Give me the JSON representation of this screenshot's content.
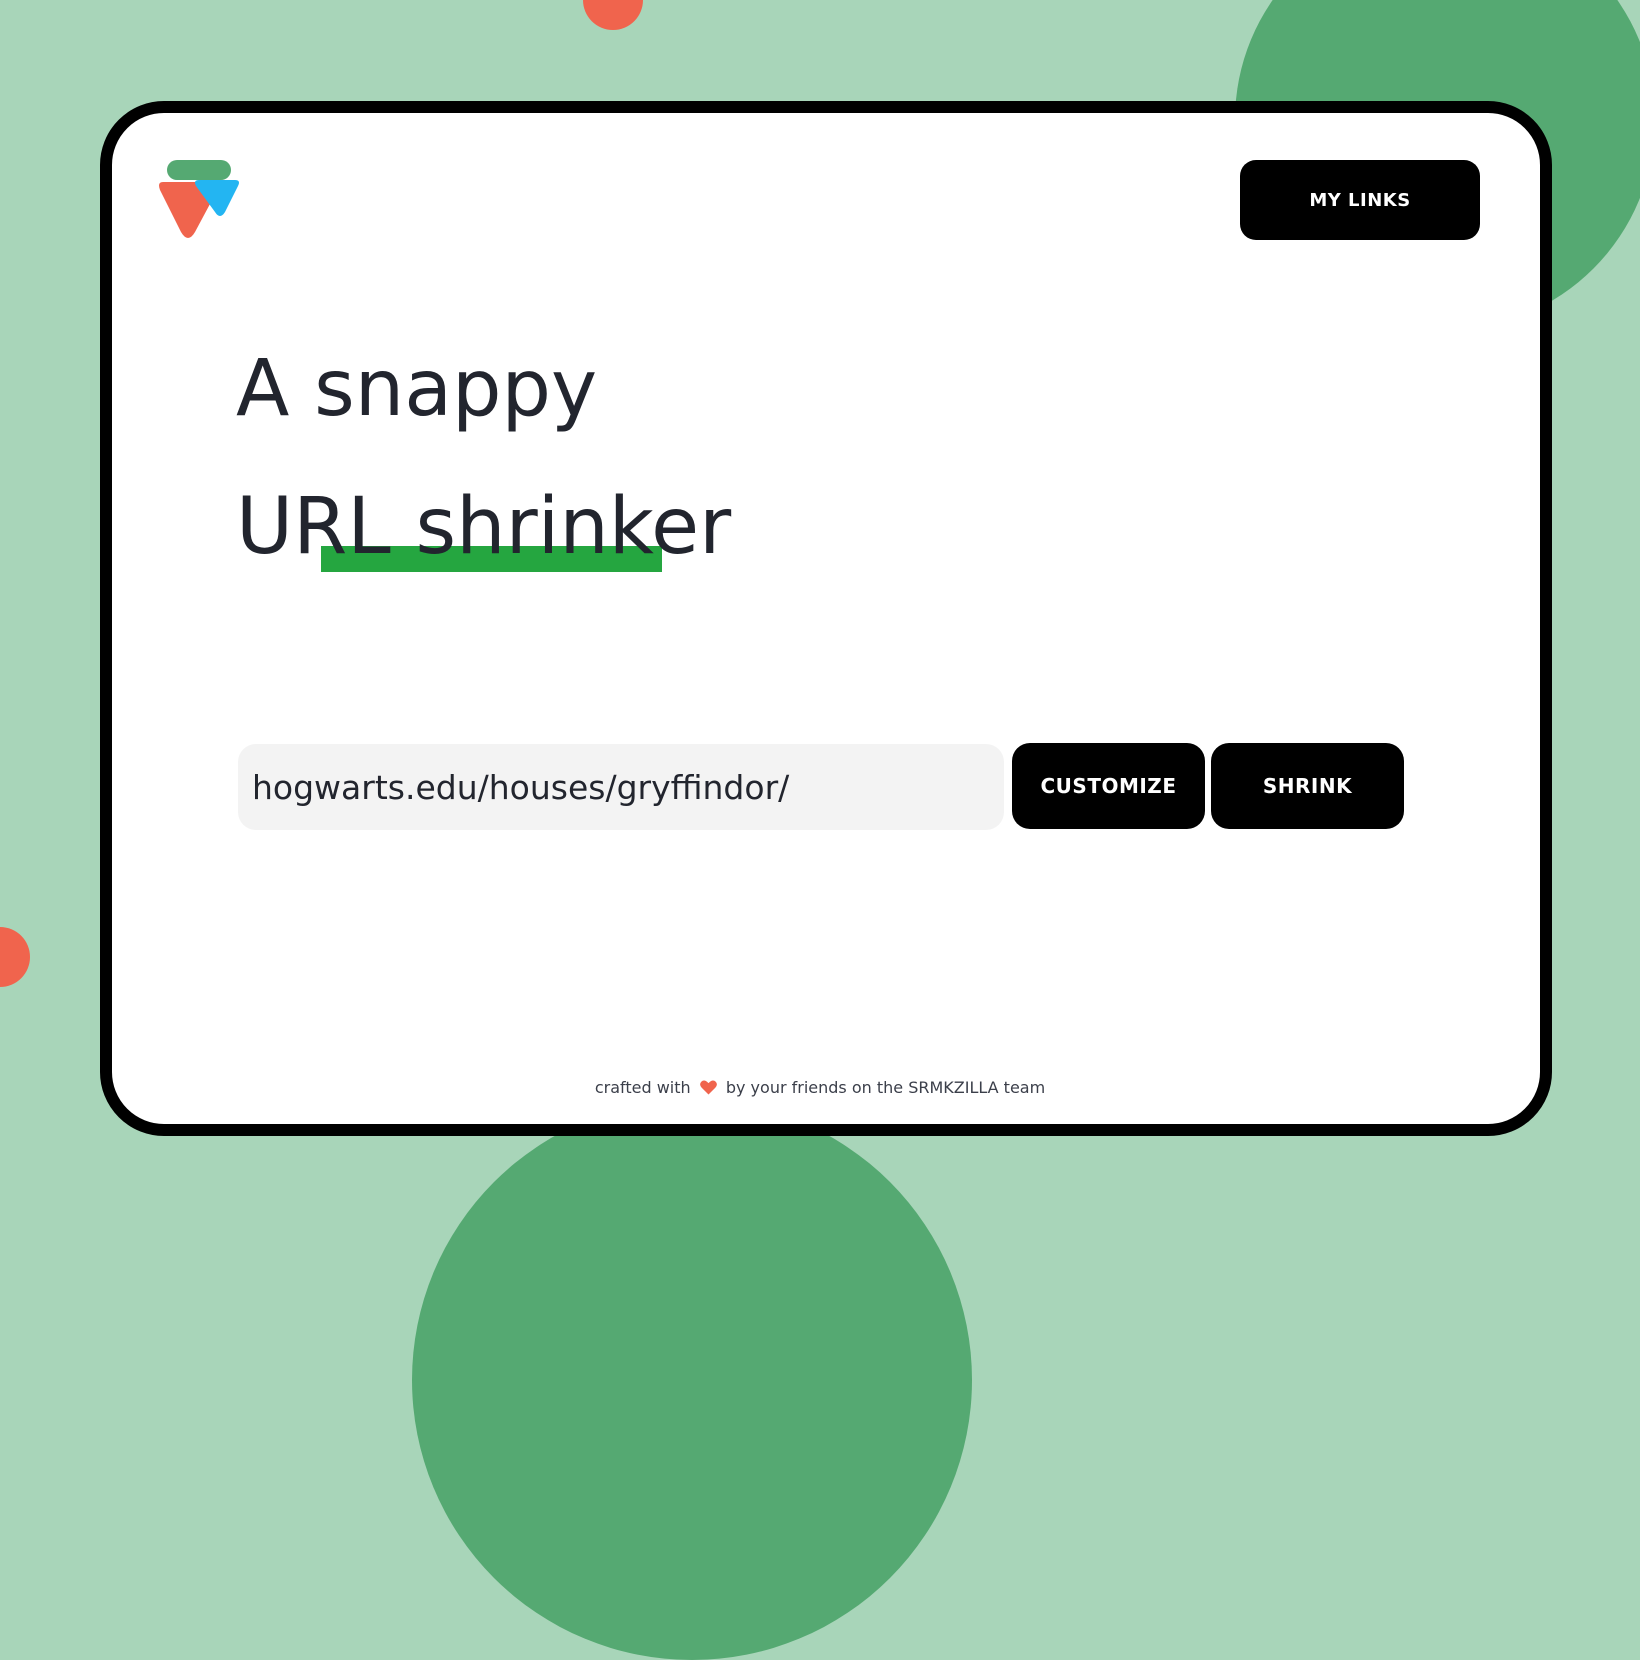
{
  "colors": {
    "background": "#a8d5b9",
    "blob_green": "#55a972",
    "accent_red": "#f0644d",
    "accent_blue": "#23b5f2",
    "highlight_green": "#25a640",
    "card": "#ffffff",
    "button": "#000000",
    "input_bg": "#f3f3f3"
  },
  "header": {
    "logo": "srmkzilla-logo",
    "my_links_label": "MY LINKS"
  },
  "hero": {
    "line1": "A snappy",
    "line2": "URL shrinker"
  },
  "shortener": {
    "url_value": "hogwarts.edu/houses/gryffindor/",
    "customize_label": "CUSTOMIZE",
    "shrink_label": "SHRINK"
  },
  "footer": {
    "prefix": "crafted with",
    "icon": "heart-icon",
    "suffix": "by your friends on the SRMKZILLA team"
  }
}
